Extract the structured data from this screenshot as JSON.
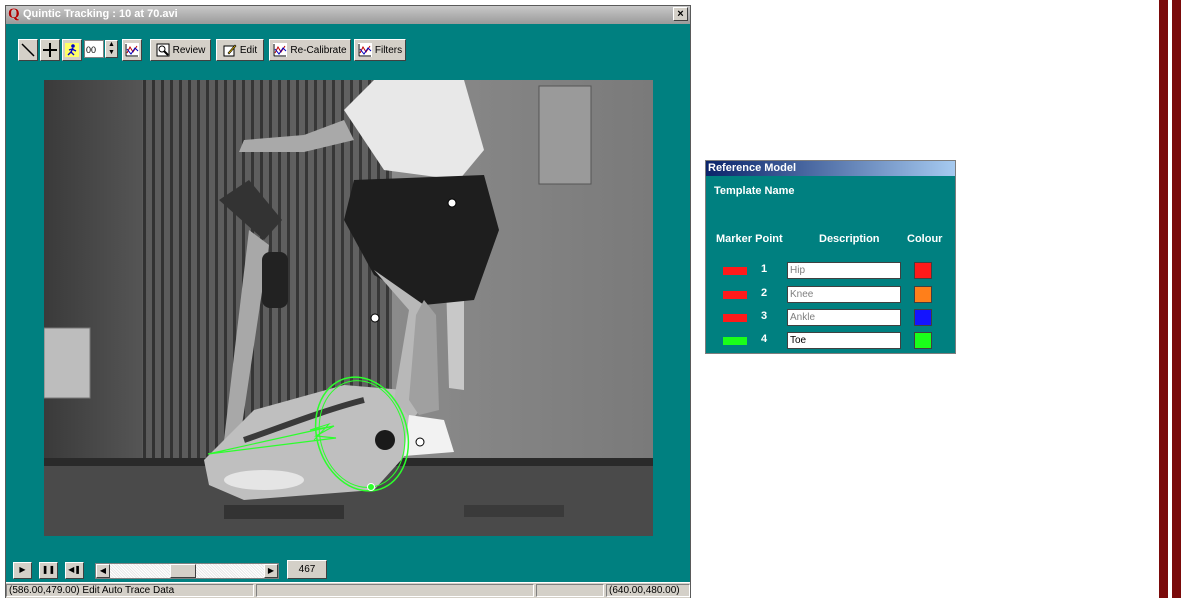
{
  "window": {
    "title": "Quintic Tracking : 10 at 70.avi",
    "logo": "Q",
    "close_label": "×"
  },
  "toolbar": {
    "spin_value": "00",
    "review_label": "Review",
    "edit_label": "Edit",
    "recalibrate_label": "Re-Calibrate",
    "filters_label": "Filters"
  },
  "playback": {
    "frame_number": "467",
    "scroll_position": 0.47
  },
  "status": {
    "cursor_coords": "(586.00,479.00)",
    "mode": "Edit Auto Trace Data",
    "image_size": "(640.00,480.00)"
  },
  "reference_model": {
    "title": "Reference Model",
    "template_label": "Template Name",
    "col_marker_point": "Marker Point",
    "col_description": "Description",
    "col_colour": "Colour",
    "markers": [
      {
        "number": "1",
        "description": "Hip",
        "marker_color": "#ff1a1a",
        "colour": "#ff1a1a",
        "active": false
      },
      {
        "number": "2",
        "description": "Knee",
        "marker_color": "#ff1a1a",
        "colour": "#ff7f1a",
        "active": false
      },
      {
        "number": "3",
        "description": "Ankle",
        "marker_color": "#ff1a1a",
        "colour": "#1414ff",
        "active": false
      },
      {
        "number": "4",
        "description": "Toe",
        "marker_color": "#1aff1a",
        "colour": "#1aff1a",
        "active": true
      }
    ]
  },
  "colors": {
    "window_bg": "#008080",
    "accent_bar": "#7a0a0a",
    "trace": "#2cff2c"
  }
}
